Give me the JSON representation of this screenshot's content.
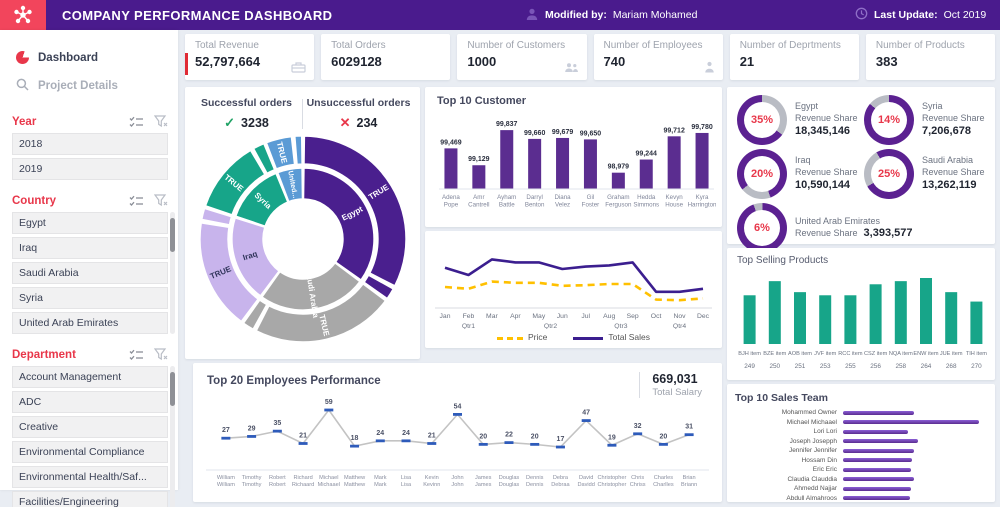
{
  "header": {
    "title": "COMPANY PERFORMANCE DASHBOARD",
    "modified_by_label": "Modified by:",
    "modified_by": "Mariam Mohamed",
    "last_update_label": "Last Update:",
    "last_update": "Oct 2019"
  },
  "sidebar": {
    "nav": [
      {
        "label": "Dashboard"
      },
      {
        "label": "Project Details"
      }
    ],
    "filters": [
      {
        "title": "Year",
        "items": [
          "2018",
          "2019"
        ]
      },
      {
        "title": "Country",
        "items": [
          "Egypt",
          "Iraq",
          "Saudi Arabia",
          "Syria",
          "United Arab Emirates"
        ]
      },
      {
        "title": "Department",
        "items": [
          "Account Management",
          "ADC",
          "Creative",
          "Environmental Compliance",
          "Environmental Health/Saf...",
          "Facilities/Engineering"
        ]
      }
    ]
  },
  "kpis": [
    {
      "label": "Total Revenue",
      "value": "52,797,664",
      "icon": "briefcase-icon"
    },
    {
      "label": "Total Orders",
      "value": "6029128",
      "icon": null
    },
    {
      "label": "Number of Customers",
      "value": "1000",
      "icon": "customers-icon"
    },
    {
      "label": "Number of Employees",
      "value": "740",
      "icon": "person-icon"
    },
    {
      "label": "Number of Deprtments",
      "value": "21",
      "icon": null
    },
    {
      "label": "Number of Products",
      "value": "383",
      "icon": null
    }
  ],
  "orders": {
    "success_label": "Successful orders",
    "success_value": "3238",
    "fail_label": "Unsuccessful orders",
    "fail_value": "234"
  },
  "chart_data": [
    {
      "type": "pie",
      "variant": "sunburst-donut",
      "legend_note": "inner ring = country, outer ring = TRUE share",
      "segments": [
        {
          "name": "Egypt",
          "share_pct": 35,
          "color": "#4A1F8E",
          "ring_label": "TRUE",
          "name_color": "#ffffff",
          "label_color": "#ffffff"
        },
        {
          "name": "Saudi Arabia",
          "share_pct": 25,
          "color": "#A8A8A8",
          "ring_label": "TRUE",
          "name_color": "#ffffff",
          "label_color": "#ffffff"
        },
        {
          "name": "Iraq",
          "share_pct": 20,
          "color": "#C8B4EC",
          "ring_label": "TRUE",
          "name_color": "#30345A",
          "label_color": "#30345A"
        },
        {
          "name": "Syria",
          "share_pct": 14,
          "color": "#17A589",
          "ring_label": "TRUE",
          "name_color": "#ffffff",
          "label_color": "#ffffff"
        },
        {
          "name": "United...",
          "share_pct": 6,
          "color": "#5B9BD5",
          "ring_label": "TRUE",
          "name_color": "#ffffff",
          "label_color": "#ffffff"
        }
      ]
    },
    {
      "type": "bar",
      "title": "Top 10 Customer",
      "bar_color": "#5B2D90",
      "categories": [
        "Adena Pope",
        "Amr Cantrell",
        "Ayham Battle",
        "Darryl Benton",
        "Diana Velez",
        "Gil Foster",
        "Graham Ferguson",
        "Hedda Simmons",
        "Kevyn House",
        "Kyra Harrington"
      ],
      "values": [
        99469,
        99129,
        99837,
        99660,
        99679,
        99650,
        98979,
        99244,
        99712,
        99780
      ],
      "labels": [
        "99,469",
        "99,129",
        "99,837",
        "99,660",
        "99,679",
        "99,650",
        "98,979",
        "99,244",
        "99,712",
        "99,780"
      ]
    },
    {
      "type": "line",
      "x": [
        "Jan",
        "Feb",
        "Mar",
        "Apr",
        "May",
        "Jun",
        "Jul",
        "Aug",
        "Sep",
        "Oct",
        "Nov",
        "Dec"
      ],
      "quarters": [
        "Qtr1",
        "Qtr2",
        "Qtr3",
        "Qtr4"
      ],
      "series": [
        {
          "name": "Price",
          "color": "#FFC000",
          "dashed": true,
          "values": [
            30,
            27,
            39,
            37,
            37,
            32,
            33,
            35,
            35,
            9,
            8,
            11
          ]
        },
        {
          "name": "Total Sales",
          "color": "#3B1E8F",
          "dashed": false,
          "values": [
            62,
            50,
            76,
            71,
            71,
            60,
            64,
            66,
            71,
            22,
            22,
            27
          ]
        }
      ],
      "legend_position": "bottom"
    },
    {
      "type": "line",
      "title": "Top 20 Employees Performance",
      "total_salary": "669,031",
      "total_salary_label": "Total Salary",
      "line_color": "#C3C3C3",
      "marker_color": "#2E5BBA",
      "categories": [
        "William William",
        "Timothy Timothy",
        "Robert Robert",
        "Richard Richaard",
        "Michael Michaael",
        "Matthew Matthew",
        "Mark Mark",
        "Lisa Lisa",
        "Kevin Kevinn",
        "John John",
        "James James",
        "Douglas Douglas",
        "Dennis Dennis",
        "Debra Debraa",
        "David Davidd",
        "Christopher Christopher",
        "Chris Chriss",
        "Charles Charlles",
        "Brian Briann"
      ],
      "values": [
        27,
        29,
        35,
        21,
        59,
        18,
        24,
        24,
        21,
        54,
        20,
        22,
        20,
        17,
        47,
        19,
        32,
        20,
        31
      ]
    },
    {
      "type": "pie",
      "variant": "gauge-grid",
      "share_label": "Revenue Share",
      "ring_color": "#5B2191",
      "ring_rest_color": "#B9BCC4",
      "pct_color": "#E8374A",
      "items": [
        {
          "country": "Egypt",
          "pct": "35%",
          "value": "18,345,146"
        },
        {
          "country": "Syria",
          "pct": "14%",
          "value": "7,206,678"
        },
        {
          "country": "Iraq",
          "pct": "20%",
          "value": "10,590,144"
        },
        {
          "country": "Saudi Arabia",
          "pct": "25%",
          "value": "13,262,119"
        },
        {
          "country": "United Arab Emirates",
          "pct": "6%",
          "value": "3,393,577"
        }
      ]
    },
    {
      "type": "bar",
      "title": "Top Selling Products",
      "bar_color": "#17A589",
      "categories": [
        "BJH item",
        "BZE item",
        "AOB item",
        "JVF item",
        "RCC item",
        "CSZ item",
        "NQA item",
        "ENW item",
        "JUE item",
        "TIH item"
      ],
      "axis_values": [
        "249",
        "250",
        "251",
        "253",
        "255",
        "256",
        "258",
        "264",
        "268",
        "270"
      ],
      "values": [
        62,
        80,
        66,
        62,
        62,
        76,
        80,
        84,
        66,
        54
      ]
    },
    {
      "type": "bar-horizontal",
      "title": "Top 10 Sales Team",
      "bar_color": "#5B2D90",
      "categories": [
        "Mohammed Owner",
        "Michael Michaael",
        "Lori Lori",
        "Joseph Josepph",
        "Jennifer Jennifer",
        "Hossam Din",
        "Eric Eric",
        "Claudia Clauddia",
        "Ahmedd Najjar",
        "Abdull Almahroos"
      ],
      "values": [
        52,
        100,
        48,
        55,
        52,
        51,
        50,
        52,
        50,
        49
      ]
    }
  ]
}
